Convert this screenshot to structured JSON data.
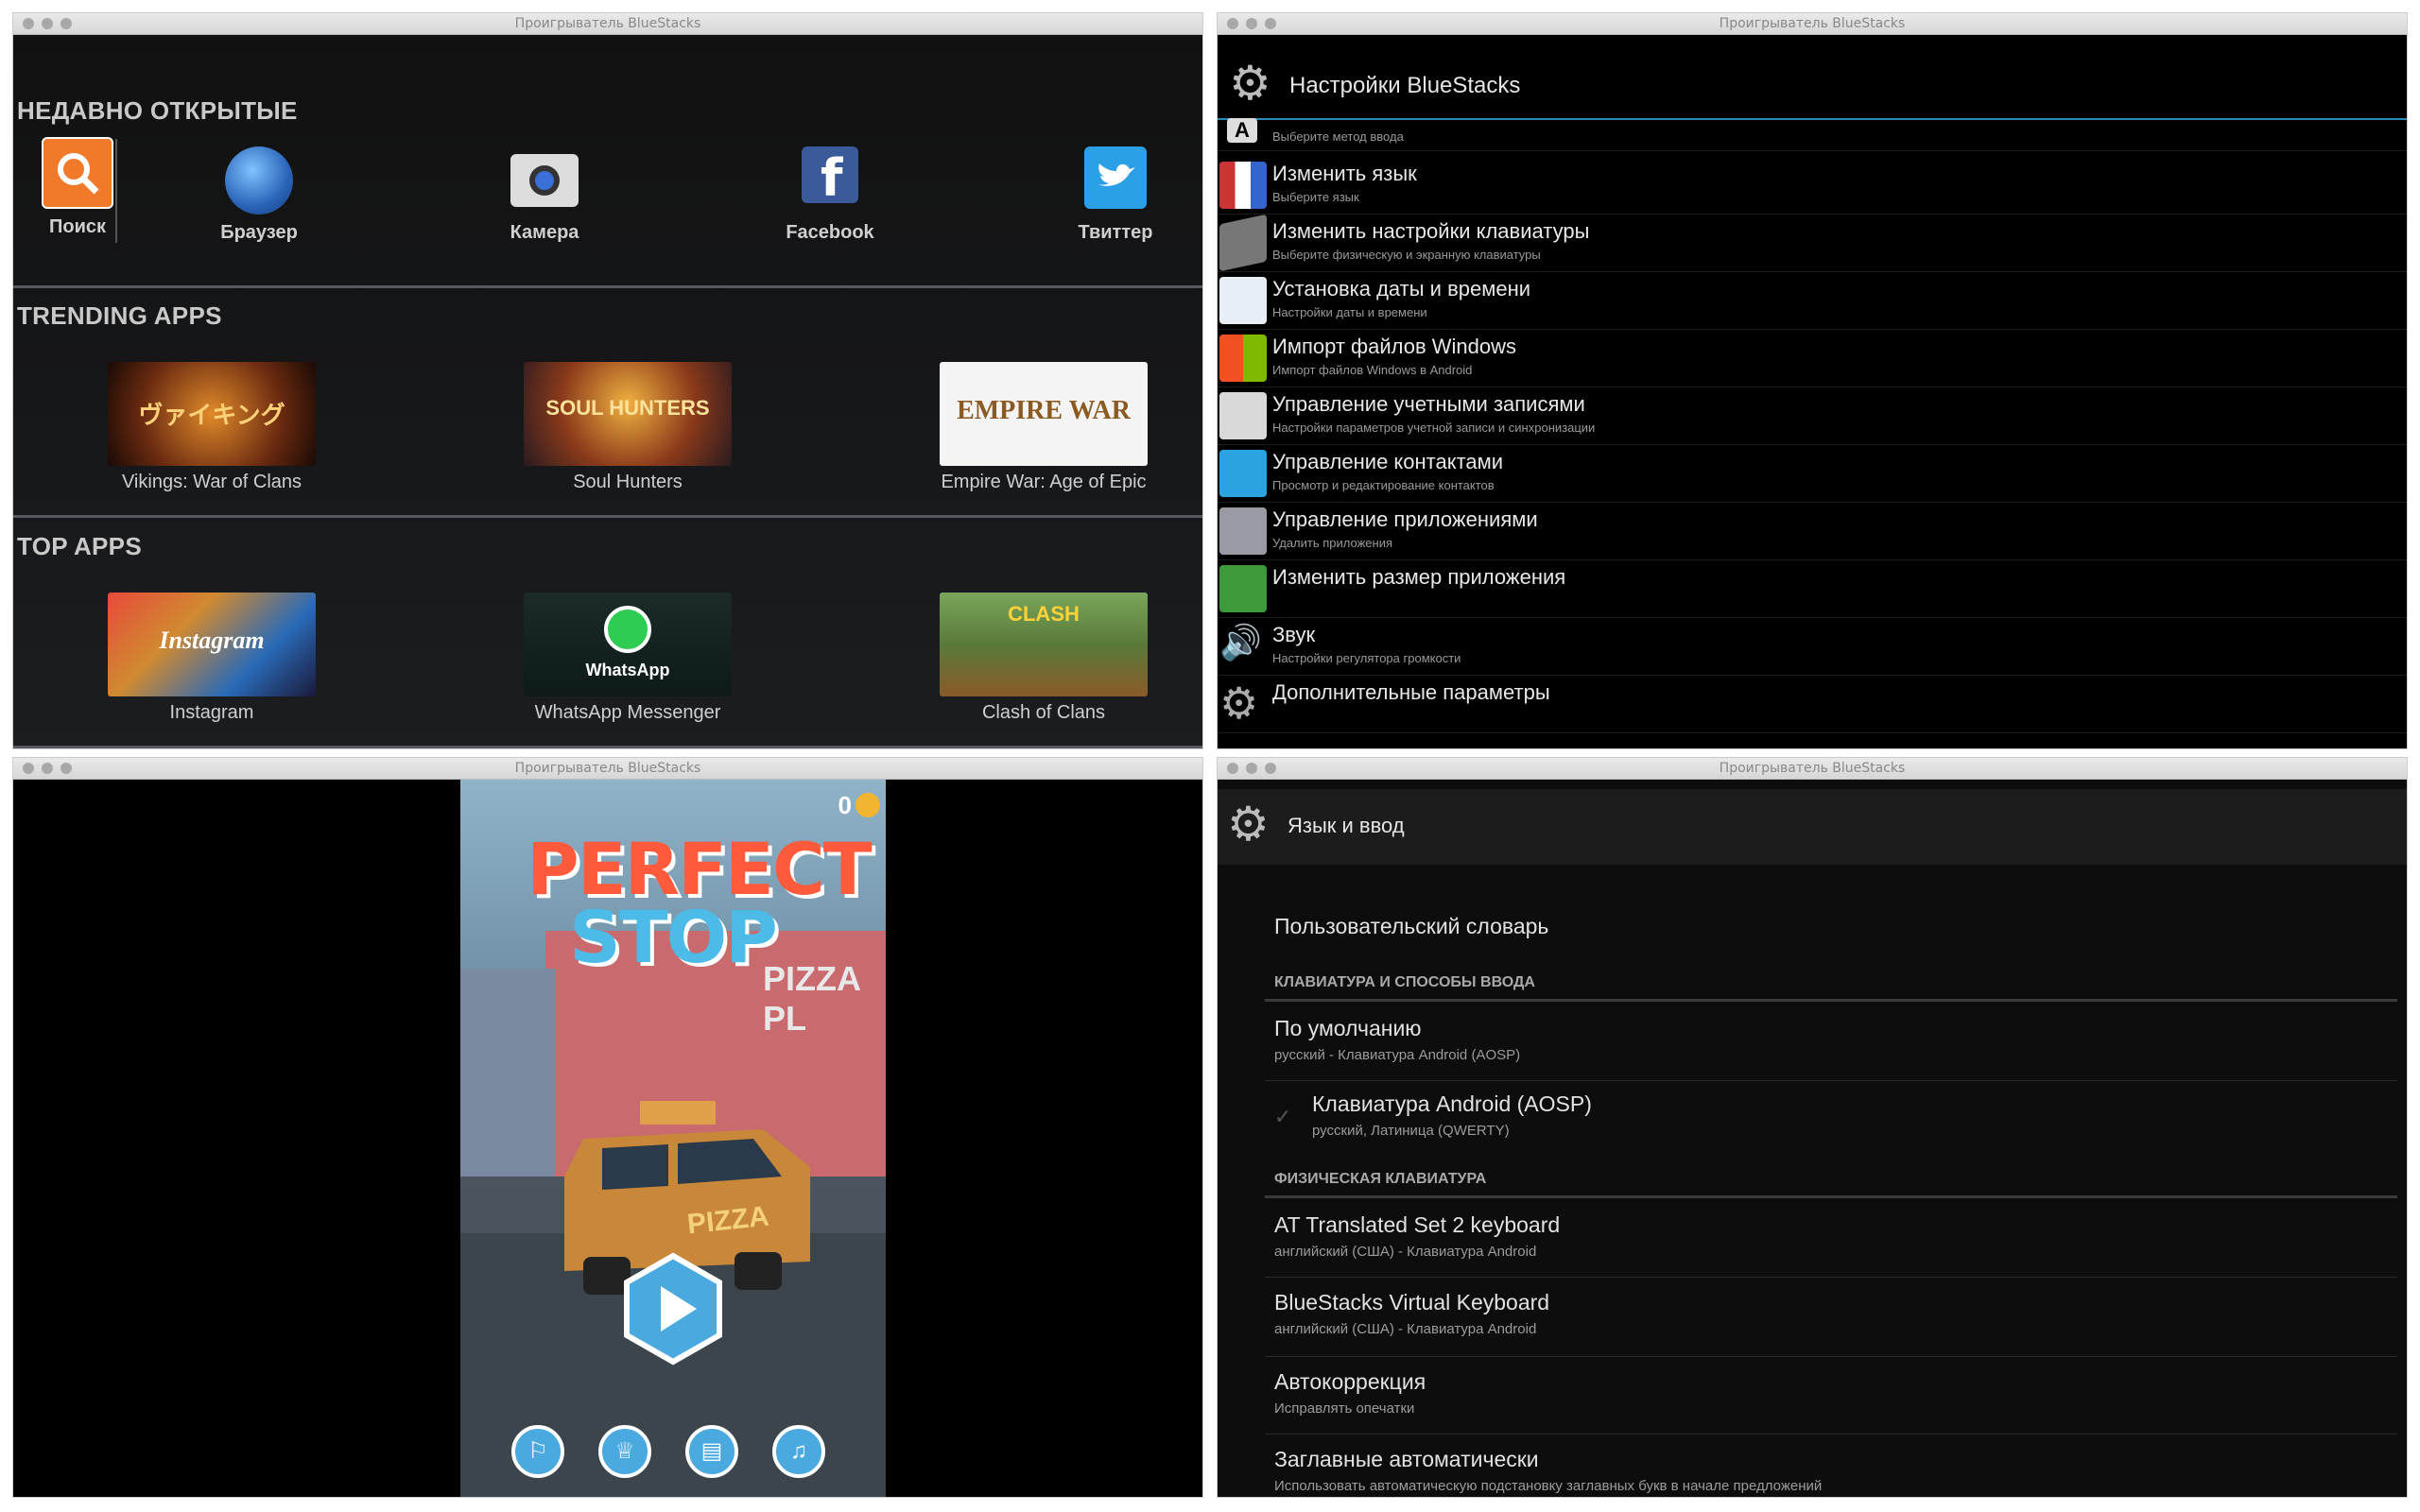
{
  "window_title": "Проигрыватель BlueStacks",
  "home": {
    "recent_title": "НЕДАВНО ОТКРЫТЫЕ",
    "recent": [
      {
        "label": "Поиск",
        "color": "#f07a2a"
      },
      {
        "label": "Браузер",
        "color": "#3b7fcc"
      },
      {
        "label": "Камера",
        "color": "#d9d9d9"
      },
      {
        "label": "Facebook",
        "color": "#3b5a9a"
      },
      {
        "label": "Твиттер",
        "color": "#2ba0e6"
      }
    ],
    "trending_title": "TRENDING APPS",
    "trending": [
      {
        "label": "Vikings: War of Clans",
        "art": "ヴァイキング"
      },
      {
        "label": "Soul Hunters",
        "art": "SOUL HUNTERS"
      },
      {
        "label": "Empire War: Age of Epic",
        "art": "EMPIRE WAR"
      }
    ],
    "top_title": "TOP APPS",
    "top": [
      {
        "label": "Instagram",
        "art": "Instagram"
      },
      {
        "label": "WhatsApp Messenger",
        "art": "WhatsApp"
      },
      {
        "label": "Clash of Clans",
        "art": "CLASH"
      }
    ]
  },
  "settings": {
    "title": "Настройки BlueStacks",
    "rows": [
      {
        "title": "Изменить язык",
        "sub": "Выберите язык",
        "icon": "flags-icon"
      },
      {
        "title": "Изменить настройки клавиатуры",
        "sub": "Выберите физическую и экранную клавиатуры",
        "icon": "keyboard-icon"
      },
      {
        "title": "Установка даты и времени",
        "sub": "Настройки даты и времени",
        "icon": "calendar-icon"
      },
      {
        "title": "Импорт файлов Windows",
        "sub": "Импорт файлов Windows в Android",
        "icon": "windows-icon"
      },
      {
        "title": "Управление учетными записями",
        "sub": "Настройки параметров учетной записи и синхронизации",
        "icon": "account-icon"
      },
      {
        "title": "Управление контактами",
        "sub": "Просмотр и редактирование контактов",
        "icon": "contacts-icon"
      },
      {
        "title": "Управление приложениями",
        "sub": "Удалить приложения",
        "icon": "apps-icon"
      },
      {
        "title": "Изменить размер приложения",
        "sub": "",
        "icon": "resize-icon"
      },
      {
        "title": "Звук",
        "sub": "Настройки регулятора громкости",
        "icon": "speaker-icon"
      },
      {
        "title": "Дополнительные параметры",
        "sub": "",
        "icon": "gear-icon"
      }
    ],
    "partial_sub": "Выберите метод ввода"
  },
  "game": {
    "title_1": "PERFECT",
    "title_2": "STOP",
    "score": "0",
    "sign": "PIZZA PL",
    "van_text": "PIZZA"
  },
  "lang": {
    "title": "Язык и ввод",
    "user_dict": "Пользовательский словарь",
    "cat_keyboard": "КЛАВИАТУРА И СПОСОБЫ ВВОДА",
    "default_title": "По умолчанию",
    "default_sub": "русский - Клавиатура Android (AOSP)",
    "aosp_title": "Клавиатура Android (AOSP)",
    "aosp_sub": "русский, Латиница (QWERTY)",
    "cat_physical": "ФИЗИЧЕСКАЯ КЛАВИАТУРА",
    "at_title": "AT Translated Set 2 keyboard",
    "at_sub": "английский (США) - Клавиатура Android",
    "bs_title": "BlueStacks Virtual Keyboard",
    "bs_sub": "английский (США) - Клавиатура Android",
    "auto_title": "Автокоррекция",
    "auto_sub": "Исправлять опечатки",
    "caps_title": "Заглавные автоматически",
    "caps_sub": "Использовать автоматическую подстановку заглавных букв в начале предложений"
  }
}
